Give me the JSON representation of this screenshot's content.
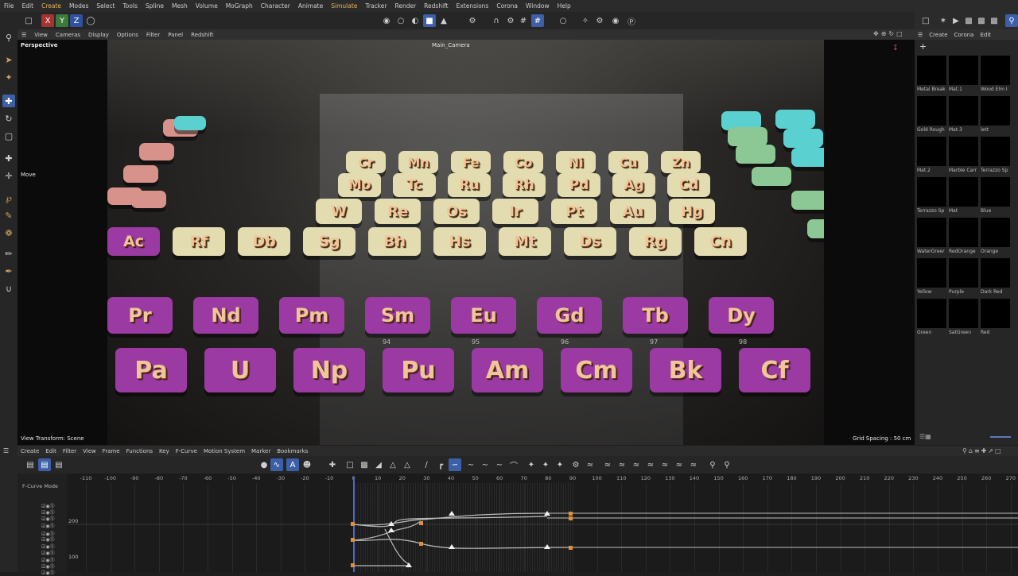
{
  "menubar": [
    "File",
    "Edit",
    "Create",
    "Modes",
    "Select",
    "Tools",
    "Spline",
    "Mesh",
    "Volume",
    "MoGraph",
    "Character",
    "Animate",
    "Simulate",
    "Tracker",
    "Render",
    "Redshift",
    "Extensions",
    "Corona",
    "Window",
    "Help"
  ],
  "toolbar": {
    "axis_x": "X",
    "axis_y": "Y",
    "axis_z": "Z"
  },
  "viewport": {
    "menu": [
      "View",
      "Cameras",
      "Display",
      "Options",
      "Filter",
      "Panel",
      "Redshift"
    ],
    "label_perspective": "Perspective",
    "label_camera": "Main_Camera",
    "label_move": "Move",
    "label_transform": "View Transform: Scene",
    "label_grid": "Grid Spacing : 50 cm"
  },
  "tiles_row1": [
    "Cr",
    "Mn",
    "Fe",
    "Co",
    "Ni",
    "Cu",
    "Zn"
  ],
  "tiles_row2": [
    "Mo",
    "Tc",
    "Ru",
    "Rh",
    "Pd",
    "Ag",
    "Cd"
  ],
  "tiles_row3": [
    "W",
    "Re",
    "Os",
    "Ir",
    "Pt",
    "Au",
    "Hg"
  ],
  "tiles_row4": [
    "Ac",
    "Rf",
    "Db",
    "Sg",
    "Bh",
    "Hs",
    "Mt",
    "Ds",
    "Rg",
    "Cn"
  ],
  "tiles_row5": [
    "Pr",
    "Nd",
    "Pm",
    "Sm",
    "Eu",
    "Gd",
    "Tb",
    "Dy"
  ],
  "tiles_row6": [
    "Pa",
    "U",
    "Np",
    "Pu",
    "Am",
    "Cm",
    "Bk",
    "Cf"
  ],
  "tile_numbers_row6": [
    "94",
    "95",
    "96",
    "97",
    "98"
  ],
  "right_panel": {
    "menu": [
      "Create",
      "Corona",
      "Edit"
    ],
    "materials": [
      "Metal Break",
      "Mat.1",
      "Wood Elm I",
      "Gold Rough",
      "Mat.3",
      "lett",
      "Mat.2",
      "Marble Carr",
      "Terrazzo Sp",
      "Terrazzo Sp",
      "Mat",
      "Blue",
      "WaterGreer",
      "RedOrange",
      "Orange",
      "Yellow",
      "Purple",
      "Dark Red",
      "Green",
      "SatGreen",
      "Red"
    ]
  },
  "timeline": {
    "menu": [
      "Create",
      "Edit",
      "Filter",
      "View",
      "Frame",
      "Functions",
      "Key",
      "F-Curve",
      "Motion System",
      "Marker",
      "Bookmarks"
    ],
    "mode_label": "F-Curve Mode",
    "ticks": [
      "-110",
      "-100",
      "-90",
      "-80",
      "-70",
      "-60",
      "-50",
      "-40",
      "-30",
      "-20",
      "-10",
      "0",
      "10",
      "20",
      "30",
      "40",
      "50",
      "60",
      "70",
      "80",
      "90",
      "100",
      "110",
      "120",
      "130",
      "140",
      "150",
      "160",
      "170",
      "180",
      "190",
      "200",
      "210",
      "220",
      "230",
      "240",
      "250",
      "260",
      "270"
    ],
    "value_labels": [
      "200",
      "100"
    ]
  }
}
